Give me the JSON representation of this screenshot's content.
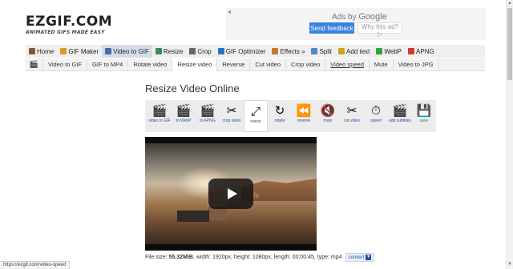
{
  "logo": {
    "text": "EZGIF.COM",
    "tagline": "ANIMATED GIFS MADE EASY"
  },
  "ad": {
    "mark": "◂",
    "ads_by": "Ads by",
    "google": "Google",
    "send_feedback": "Send feedback",
    "why_this_ad": "Why this ad? ▷"
  },
  "main_nav": [
    {
      "label": "Home",
      "icon": "home-icon",
      "color": "#7a5a3a"
    },
    {
      "label": "GIF Maker",
      "icon": "gif-maker-icon",
      "color": "#d69a2a"
    },
    {
      "label": "Video to GIF",
      "icon": "video-icon",
      "color": "#4a6aa8"
    },
    {
      "label": "Resize",
      "icon": "resize-icon",
      "color": "#3a8a5a"
    },
    {
      "label": "Crop",
      "icon": "crop-icon",
      "color": "#666666"
    },
    {
      "label": "GIF Optimizer",
      "icon": "optimizer-icon",
      "color": "#2a70c8"
    },
    {
      "label": "Effects »",
      "icon": "effects-icon",
      "color": "#c07a2a"
    },
    {
      "label": "Split",
      "icon": "split-icon",
      "color": "#4a8ac8"
    },
    {
      "label": "Add text",
      "icon": "add-text-icon",
      "color": "#d0a020"
    },
    {
      "label": "WebP",
      "icon": "webp-icon",
      "color": "#3aa03a"
    },
    {
      "label": "APNG",
      "icon": "apng-icon",
      "color": "#d03a2a"
    }
  ],
  "sub_nav": {
    "film_icon": "🎬",
    "items": [
      "Video to GIF",
      "GIF to MP4",
      "Rotate video",
      "Resize video",
      "Reverse",
      "Cut video",
      "Crop video",
      "Video speed",
      "Mute",
      "Video to JPG"
    ]
  },
  "page_title": "Resize Video Online",
  "tools": [
    {
      "label": "video to GIF",
      "icon": "clapperboard-icon",
      "glyph": "🎬"
    },
    {
      "label": "to WebP",
      "icon": "clapperboard-icon",
      "glyph": "🎬"
    },
    {
      "label": "to APNG",
      "icon": "clapperboard-icon",
      "glyph": "🎬"
    },
    {
      "label": "crop video",
      "icon": "crop-icon",
      "glyph": "✂"
    },
    {
      "label": "resize",
      "icon": "resize-icon",
      "glyph": "⤢"
    },
    {
      "label": "rotate",
      "icon": "rotate-icon",
      "glyph": "↻"
    },
    {
      "label": "reverse",
      "icon": "reverse-icon",
      "glyph": "⏪"
    },
    {
      "label": "mute",
      "icon": "mute-icon",
      "glyph": "🔇"
    },
    {
      "label": "cut video",
      "icon": "scissors-icon",
      "glyph": "✂"
    },
    {
      "label": "speed",
      "icon": "speed-icon",
      "glyph": "⏱"
    },
    {
      "label": "add subtitles",
      "icon": "subtitles-icon",
      "glyph": "🎬"
    },
    {
      "label": "save",
      "icon": "save-icon",
      "glyph": "💾"
    }
  ],
  "video": {
    "watermark": "Life"
  },
  "file_info": {
    "prefix": "File size: ",
    "size": "55.32MiB",
    "rest": ", width: 1920px, height: 1080px, length: 00:00:45, type: mp4",
    "convert_label": "convert",
    "convert_icon": "▾"
  },
  "status_bar": "https://ezgif.com/video-speed",
  "scrollbar": {
    "up": "▲",
    "down": "▼"
  },
  "state": {
    "main_nav_active": 2,
    "sub_nav_active": 3,
    "sub_nav_link": 7,
    "tool_active": 4
  }
}
